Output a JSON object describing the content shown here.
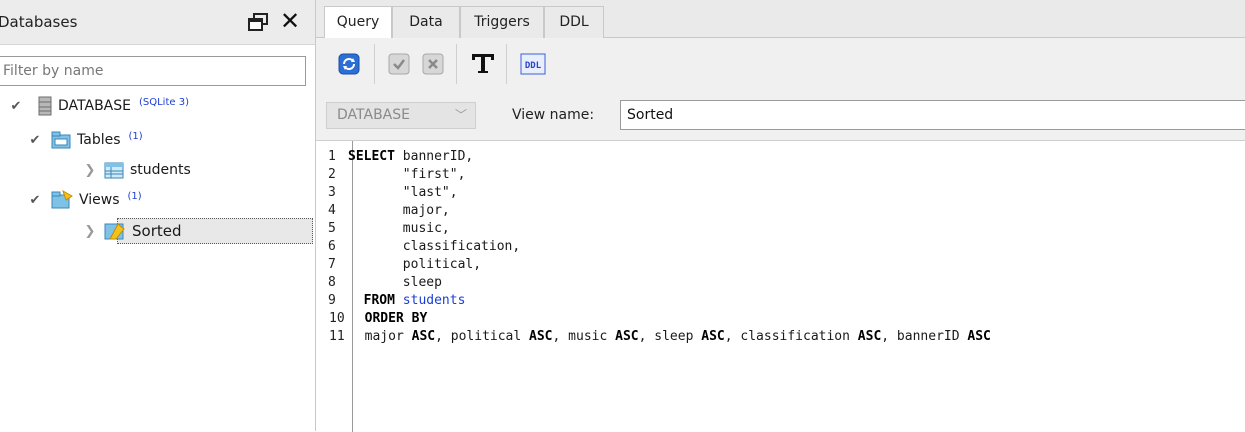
{
  "left_panel": {
    "title": "Databases",
    "filter_placeholder": "Filter by name",
    "tree": {
      "database": {
        "label": "DATABASE",
        "meta": "(SQLite 3)"
      },
      "tables": {
        "label": "Tables",
        "count": "(1)"
      },
      "students": {
        "label": "students"
      },
      "views": {
        "label": "Views",
        "count": "(1)"
      },
      "sorted": {
        "label": "Sorted"
      }
    }
  },
  "tabs": [
    {
      "label": "Query",
      "active": true
    },
    {
      "label": "Data",
      "active": false
    },
    {
      "label": "Triggers",
      "active": false
    },
    {
      "label": "DDL",
      "active": false
    }
  ],
  "toolbar": {
    "icons": [
      "refresh-icon",
      "commit-icon",
      "rollback-icon",
      "format-text-icon",
      "ddl-icon"
    ],
    "ddl_label": "DDL"
  },
  "view_row": {
    "database_select": "DATABASE",
    "view_name_label": "View name:",
    "view_name_value": "Sorted"
  },
  "editor": {
    "lines": [
      {
        "num": "1",
        "kw": "SELECT",
        "text": " bannerID,"
      },
      {
        "num": "2",
        "kw": "",
        "text": "       \"first\","
      },
      {
        "num": "3",
        "kw": "",
        "text": "       \"last\","
      },
      {
        "num": "4",
        "kw": "",
        "text": "       major,"
      },
      {
        "num": "5",
        "kw": "",
        "text": "       music,"
      },
      {
        "num": "6",
        "kw": "",
        "text": "       classification,"
      },
      {
        "num": "7",
        "kw": "",
        "text": "       political,"
      },
      {
        "num": "8",
        "kw": "",
        "text": "       sleep"
      },
      {
        "num": "9",
        "kw": "  FROM",
        "text": " ",
        "ident": "students"
      },
      {
        "num": "10",
        "kw": "  ORDER BY",
        "text": ""
      },
      {
        "num": "11",
        "kw": "",
        "text": "  major ASC, political ASC, music ASC, sleep ASC, classification ASC, bannerID ASC"
      }
    ]
  },
  "colors": {
    "accent_blue": "#1a3fd8",
    "meta_blue": "#1f3fd1",
    "panel_bg": "#f0f0f0"
  }
}
